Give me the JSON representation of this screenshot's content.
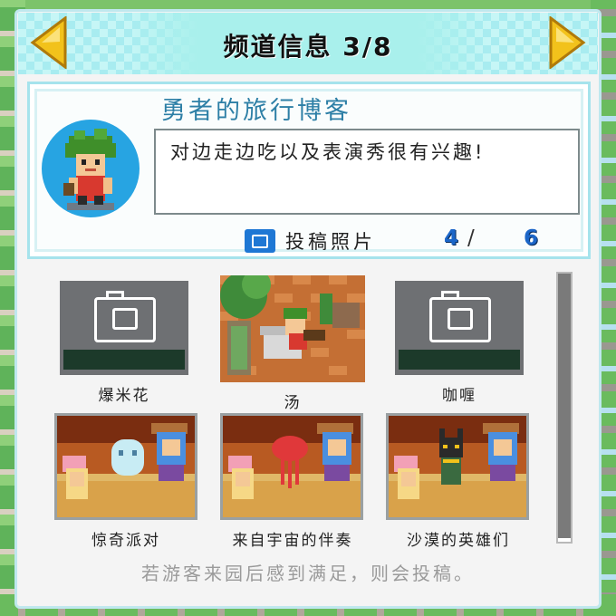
{
  "header": {
    "title": "频道信息 3/8"
  },
  "profile": {
    "name": "勇者的旅行博客",
    "description": "对边走边吃以及表演秀很有兴趣!",
    "posts_label": "投稿照片",
    "posts_count": "4",
    "posts_separator": "/",
    "posts_total": "6"
  },
  "photos": [
    {
      "caption": "爆米花",
      "state": "locked"
    },
    {
      "caption": "汤",
      "state": "unlocked"
    },
    {
      "caption": "咖喱",
      "state": "locked"
    },
    {
      "caption": "惊奇派对",
      "state": "unlocked"
    },
    {
      "caption": "来自宇宙的伴奏",
      "state": "unlocked"
    },
    {
      "caption": "沙漠的英雄们",
      "state": "unlocked"
    }
  ],
  "footer": {
    "hint": "若游客来园后感到满足，则会投稿。"
  },
  "colors": {
    "accent": "#2d7fa6",
    "header_bg": "#a9f0ec",
    "arrow_yellow": "#f2c21b",
    "count_blue": "#1c66c8"
  }
}
